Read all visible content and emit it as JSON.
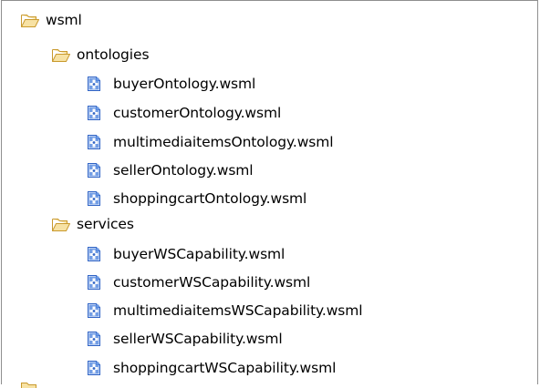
{
  "tree": {
    "root": {
      "label": "wsml",
      "icon": "open-folder-icon",
      "children": [
        {
          "label": "ontologies",
          "icon": "open-folder-icon",
          "files": [
            {
              "label": "buyerOntology.wsml",
              "icon": "wsml-file-icon"
            },
            {
              "label": "customerOntology.wsml",
              "icon": "wsml-file-icon"
            },
            {
              "label": "multimediaitemsOntology.wsml",
              "icon": "wsml-file-icon"
            },
            {
              "label": "sellerOntology.wsml",
              "icon": "wsml-file-icon"
            },
            {
              "label": "shoppingcartOntology.wsml",
              "icon": "wsml-file-icon"
            }
          ]
        },
        {
          "label": "services",
          "icon": "open-folder-icon",
          "files": [
            {
              "label": "buyerWSCapability.wsml",
              "icon": "wsml-file-icon"
            },
            {
              "label": "customerWSCapability.wsml",
              "icon": "wsml-file-icon"
            },
            {
              "label": "multimediaitemsWSCapability.wsml",
              "icon": "wsml-file-icon"
            },
            {
              "label": "sellerWSCapability.wsml",
              "icon": "wsml-file-icon"
            },
            {
              "label": "shoppingcartWSCapability.wsml",
              "icon": "wsml-file-icon"
            }
          ]
        }
      ]
    }
  },
  "colors": {
    "folder_fill": "#f7e2a4",
    "folder_stroke": "#c99a2e",
    "file_blue": "#2f63c5",
    "border": "#8f8f8f"
  }
}
